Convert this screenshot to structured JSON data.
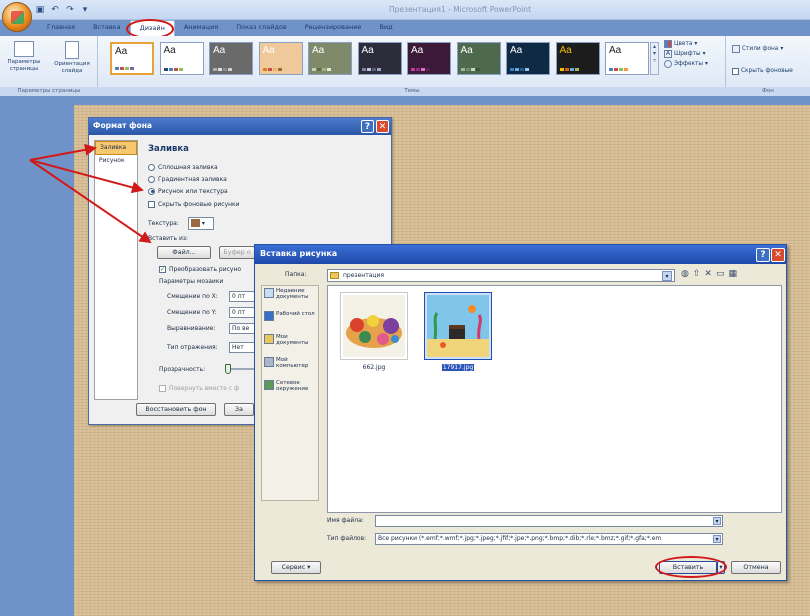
{
  "window_title": "Презентация1 - Microsoft PowerPoint",
  "tabs": [
    "Главная",
    "Вставка",
    "Дизайн",
    "Анимация",
    "Показ слайдов",
    "Рецензирование",
    "Вид"
  ],
  "ribbon": {
    "page_setup_label": "Параметры страницы",
    "orientation_label": "Ориентация слайда",
    "group_page_setup": "Параметры страницы",
    "group_themes": "Темы",
    "group_background": "Фон",
    "theme_sample": "Aa",
    "colors": "Цвета",
    "fonts": "Шрифты",
    "effects": "Эффекты",
    "bg_styles": "Стили фона",
    "hide_bg": "Скрыть фоновые"
  },
  "themes": [
    {
      "bg": "#ffffff",
      "fg": "#222222",
      "bars": [
        "#4f81bd",
        "#c0504d",
        "#9bbb59",
        "#8064a2"
      ]
    },
    {
      "bg": "#ffffff",
      "fg": "#222222",
      "bars": [
        "#1f497d",
        "#4f81bd",
        "#c0504d",
        "#9bbb59"
      ]
    },
    {
      "bg": "#6a6a6a",
      "fg": "#ffffff",
      "bars": [
        "#b0b0b0",
        "#e0e0e0",
        "#8a8a8a",
        "#d0d0d0"
      ]
    },
    {
      "bg": "#f0c99b",
      "fg": "#ffffff",
      "bars": [
        "#e07a1f",
        "#c0504d",
        "#f2b35f",
        "#9b6b3a"
      ]
    },
    {
      "bg": "#7e8a6a",
      "fg": "#ffffff",
      "bars": [
        "#c8d1b2",
        "#5e6b48",
        "#a5b07f",
        "#e3e9d2"
      ]
    },
    {
      "bg": "#2c2c3a",
      "fg": "#ffffff",
      "bars": [
        "#7a86a8",
        "#c0c6d8",
        "#55607e",
        "#9aa4c0"
      ]
    },
    {
      "bg": "#3a1a36",
      "fg": "#ffffff",
      "bars": [
        "#c5399a",
        "#8d2f7e",
        "#e06bc0",
        "#5a2050"
      ]
    },
    {
      "bg": "#4e6a4e",
      "fg": "#ffffff",
      "bars": [
        "#9ab89a",
        "#6f8f6f",
        "#c5d9c5",
        "#3c553c"
      ]
    },
    {
      "bg": "#0e2a44",
      "fg": "#ffffff",
      "bars": [
        "#3c7fbf",
        "#6fa8dc",
        "#1f5c99",
        "#9bc3e8"
      ]
    },
    {
      "bg": "#1c1c1c",
      "fg": "#f0c000",
      "bars": [
        "#f0c000",
        "#d95a1c",
        "#6fa8dc",
        "#9bbb59"
      ]
    },
    {
      "bg": "#ffffff",
      "fg": "#222222",
      "bars": [
        "#4f81bd",
        "#c0504d",
        "#9bbb59",
        "#f79646"
      ]
    }
  ],
  "format_dialog": {
    "title": "Формат фона",
    "nav": [
      "Заливка",
      "Рисунок"
    ],
    "section": "Заливка",
    "options": [
      "Сплошная заливка",
      "Градиентная заливка",
      "Рисунок или текстура",
      "Скрыть фоновые рисунки"
    ],
    "texture_label": "Текстура:",
    "insert_from": "Вставить из:",
    "file_btn": "Файл...",
    "clipboard_btn": "Буфер о",
    "tile_checkbox": "Преобразовать рисуно",
    "tile_params": "Параметры мозаики",
    "offset_x_label": "Смещение по X:",
    "offset_x_value": "0 пт",
    "offset_y_label": "Смещение по Y:",
    "offset_y_value": "0 пт",
    "align_label": "Выравнивание:",
    "align_value": "По ве",
    "mirror_label": "Тип отражения:",
    "mirror_value": "Нет",
    "transparency_label": "Прозрачность:",
    "rotate_label": "Повернуть вместе с ф",
    "reset_btn": "Восстановить фон",
    "close_btn": "За"
  },
  "insert_dialog": {
    "title": "Вставка рисунка",
    "folder_label": "Папка:",
    "folder_value": "презентация",
    "places": [
      "Недавние документы",
      "Рабочий стол",
      "Мои документы",
      "Мой компьютер",
      "Сетевое окружение"
    ],
    "files": [
      {
        "name": "662.jpg",
        "selected": false
      },
      {
        "name": "17917.jpg",
        "selected": true
      }
    ],
    "filename_label": "Имя файла:",
    "filename_value": "",
    "filetype_label": "Тип файлов:",
    "filetype_value": "Все рисунки (*.emf;*.wmf;*.jpg;*.jpeg;*.jfif;*.jpe;*.png;*.bmp;*.dib;*.rle;*.bmz;*.gif;*.gfa;*.em",
    "service_btn": "Сервис",
    "insert_btn": "Вставить",
    "cancel_btn": "Отмена"
  }
}
